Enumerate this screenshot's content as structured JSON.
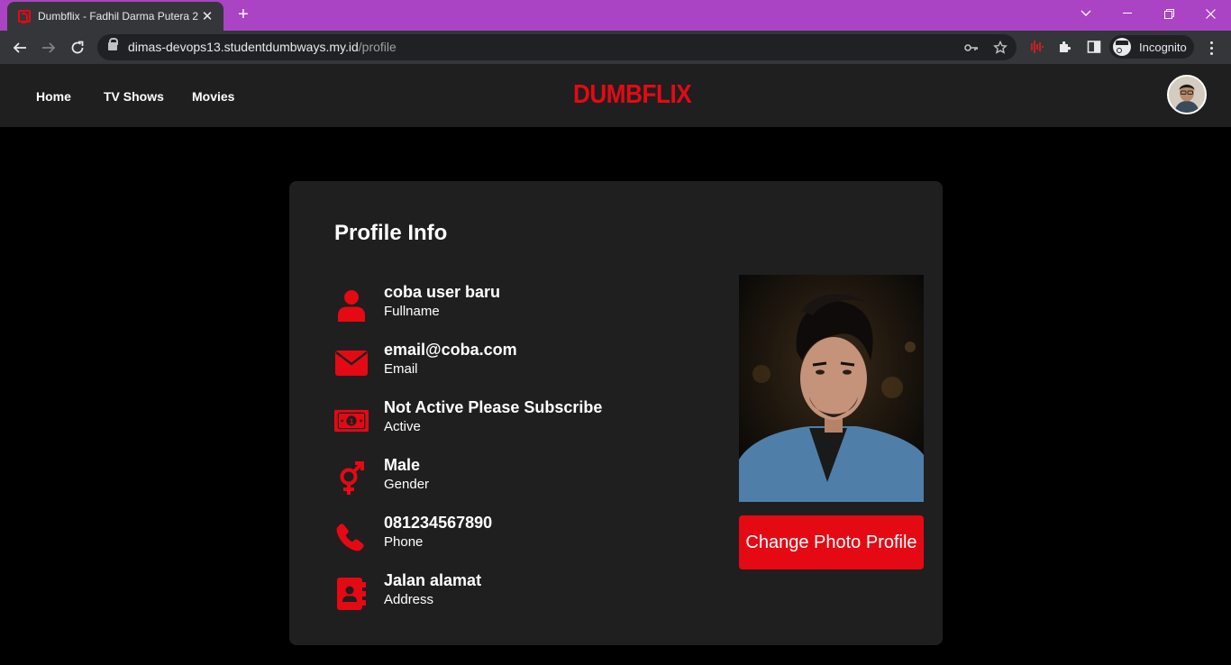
{
  "browser": {
    "tab_title": "Dumbflix - Fadhil Darma Putera 2",
    "url_host": "dimas-devops13.studentdumbways.my.id",
    "url_path": "/profile",
    "incognito_label": "Incognito",
    "accent_color": "#aa44c4"
  },
  "nav": {
    "links": [
      "Home",
      "TV Shows",
      "Movies"
    ],
    "logo": "DUMBFLIX"
  },
  "profile": {
    "title": "Profile Info",
    "items": [
      {
        "value": "coba user baru",
        "label": "Fullname",
        "icon": "user-icon"
      },
      {
        "value": "email@coba.com",
        "label": "Email",
        "icon": "envelope-icon"
      },
      {
        "value": "Not Active Please Subscribe",
        "label": "Active",
        "icon": "money-icon"
      },
      {
        "value": "Male",
        "label": "Gender",
        "icon": "gender-icon"
      },
      {
        "value": "081234567890",
        "label": "Phone",
        "icon": "phone-icon"
      },
      {
        "value": "Jalan alamat",
        "label": "Address",
        "icon": "address-book-icon"
      }
    ],
    "change_photo_label": "Change Photo Profile",
    "brand_color": "#e50914"
  }
}
